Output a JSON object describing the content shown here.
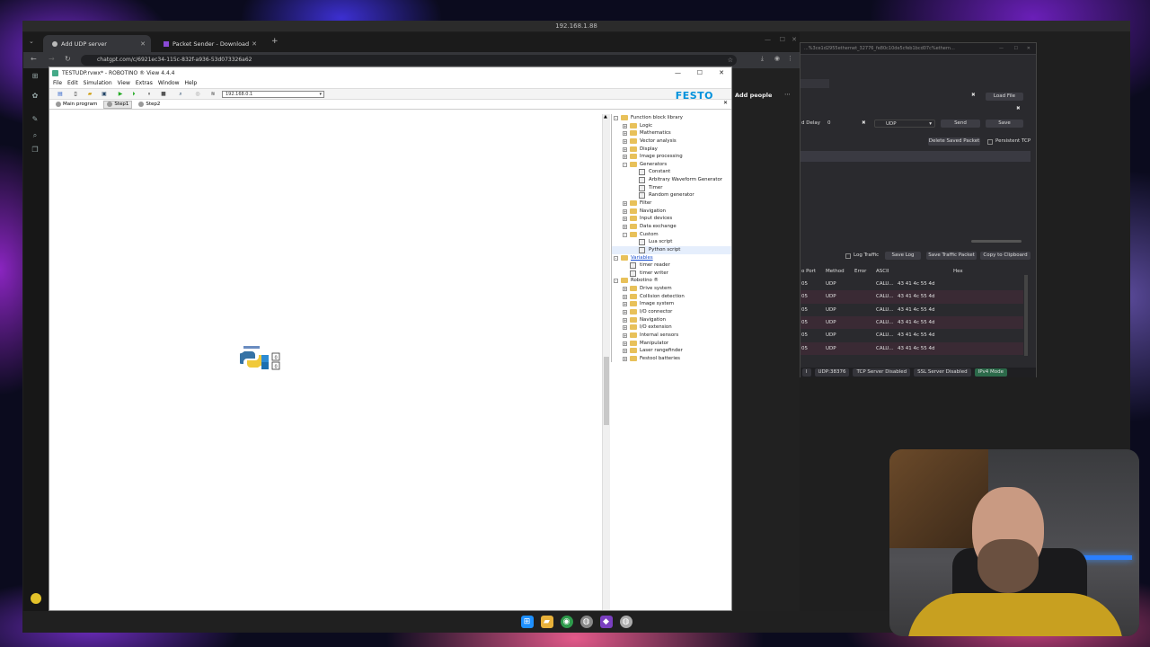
{
  "remote": {
    "title": "192.168.1.88"
  },
  "browser": {
    "tabs": [
      {
        "label": "Add UDP server",
        "active": true
      },
      {
        "label": "Packet Sender - Download",
        "active": false
      }
    ],
    "url": "chatgpt.com/c/6921ec34-115c-832f-a936-53d073326a62",
    "add_people": "Add people"
  },
  "robotino": {
    "title": "TESTUDP.rvwx* - ROBOTINO ® View 4.4.4",
    "menu": [
      "File",
      "Edit",
      "Simulation",
      "View",
      "Extras",
      "Window",
      "Help"
    ],
    "ip": "192.168.0.1",
    "brand": "FESTO",
    "tabs": [
      {
        "label": "Main program",
        "selected": false
      },
      {
        "label": "Step1",
        "selected": true
      },
      {
        "label": "Step2",
        "selected": false
      }
    ],
    "tree": [
      {
        "label": "Function block library",
        "level": 0,
        "kind": "folder",
        "exp": "−"
      },
      {
        "label": "Logic",
        "level": 1,
        "kind": "folder",
        "exp": "+"
      },
      {
        "label": "Mathematics",
        "level": 1,
        "kind": "folder",
        "exp": "+"
      },
      {
        "label": "Vector analysis",
        "level": 1,
        "kind": "folder",
        "exp": "+"
      },
      {
        "label": "Display",
        "level": 1,
        "kind": "folder",
        "exp": "+"
      },
      {
        "label": "Image processing",
        "level": 1,
        "kind": "folder",
        "exp": "+"
      },
      {
        "label": "Generators",
        "level": 1,
        "kind": "folder",
        "exp": "−"
      },
      {
        "label": "Constant",
        "level": 2,
        "kind": "leaf"
      },
      {
        "label": "Arbitrary Waveform Generator",
        "level": 2,
        "kind": "leaf"
      },
      {
        "label": "Timer",
        "level": 2,
        "kind": "leaf"
      },
      {
        "label": "Random generator",
        "level": 2,
        "kind": "leaf"
      },
      {
        "label": "Filter",
        "level": 1,
        "kind": "folder",
        "exp": "+"
      },
      {
        "label": "Navigation",
        "level": 1,
        "kind": "folder",
        "exp": "+"
      },
      {
        "label": "Input devices",
        "level": 1,
        "kind": "folder",
        "exp": "+"
      },
      {
        "label": "Data exchange",
        "level": 1,
        "kind": "folder",
        "exp": "+"
      },
      {
        "label": "Custom",
        "level": 1,
        "kind": "folder",
        "exp": "−"
      },
      {
        "label": "Lua script",
        "level": 2,
        "kind": "leaf"
      },
      {
        "label": "Python script",
        "level": 2,
        "kind": "leaf",
        "highlight": true
      },
      {
        "label": "Variables",
        "level": 0,
        "kind": "folder",
        "exp": "−",
        "link": true
      },
      {
        "label": "timer reader",
        "level": 1,
        "kind": "leaf"
      },
      {
        "label": "timer writer",
        "level": 1,
        "kind": "leaf"
      },
      {
        "label": "Robotino ®",
        "level": 0,
        "kind": "folder",
        "exp": "−"
      },
      {
        "label": "Drive system",
        "level": 1,
        "kind": "folder",
        "exp": "+"
      },
      {
        "label": "Collision detection",
        "level": 1,
        "kind": "folder",
        "exp": "+"
      },
      {
        "label": "Image system",
        "level": 1,
        "kind": "folder",
        "exp": "+"
      },
      {
        "label": "I/O connector",
        "level": 1,
        "kind": "folder",
        "exp": "+"
      },
      {
        "label": "Navigation",
        "level": 1,
        "kind": "folder",
        "exp": "+"
      },
      {
        "label": "I/O extension",
        "level": 1,
        "kind": "folder",
        "exp": "+"
      },
      {
        "label": "Internal sensors",
        "level": 1,
        "kind": "folder",
        "exp": "+"
      },
      {
        "label": "Manipulator",
        "level": 1,
        "kind": "folder",
        "exp": "+"
      },
      {
        "label": "Laser rangefinder",
        "level": 1,
        "kind": "folder",
        "exp": "+"
      },
      {
        "label": "Festool batteries",
        "level": 1,
        "kind": "folder",
        "exp": "+"
      }
    ]
  },
  "packet_sender": {
    "title": "...%3ce1d2955ethernet_32776_fe80c10de5cfeb1bcd07c%ethern...",
    "load_file": "Load File",
    "delay_label": "d Delay",
    "delay_value": "0",
    "protocol": "UDP",
    "send": "Send",
    "save": "Save",
    "delete_saved": "Delete Saved Packet",
    "persistent_tcp": "Persistent TCP",
    "log_traffic": "Log Traffic",
    "save_log": "Save Log",
    "save_traffic": "Save Traffic Packet",
    "copy_clipboard": "Copy to Clipboard",
    "columns": [
      "o Port",
      "Method",
      "Error",
      "ASCII",
      "Hex"
    ],
    "rows": [
      {
        "port": "05",
        "method": "UDP",
        "ascii": "CALU...",
        "hex": "43 41 4c 55 4d"
      },
      {
        "port": "05",
        "method": "UDP",
        "ascii": "CALU...",
        "hex": "43 41 4c 55 4d"
      },
      {
        "port": "05",
        "method": "UDP",
        "ascii": "CALU...",
        "hex": "43 41 4c 55 4d"
      },
      {
        "port": "05",
        "method": "UDP",
        "ascii": "CALU...",
        "hex": "43 41 4c 55 4d"
      },
      {
        "port": "05",
        "method": "UDP",
        "ascii": "CALU...",
        "hex": "43 41 4c 55 4d"
      },
      {
        "port": "05",
        "method": "UDP",
        "ascii": "CALU...",
        "hex": "43 41 4c 55 4d"
      }
    ],
    "status": [
      "l",
      "UDP:38376",
      "TCP Server Disabled",
      "SSL Server Disabled",
      "IPv4 Mode"
    ]
  },
  "colors": {
    "festo_blue": "#0091dc",
    "tab_active": "#35363a",
    "ps_bg": "#2a2a2e"
  }
}
